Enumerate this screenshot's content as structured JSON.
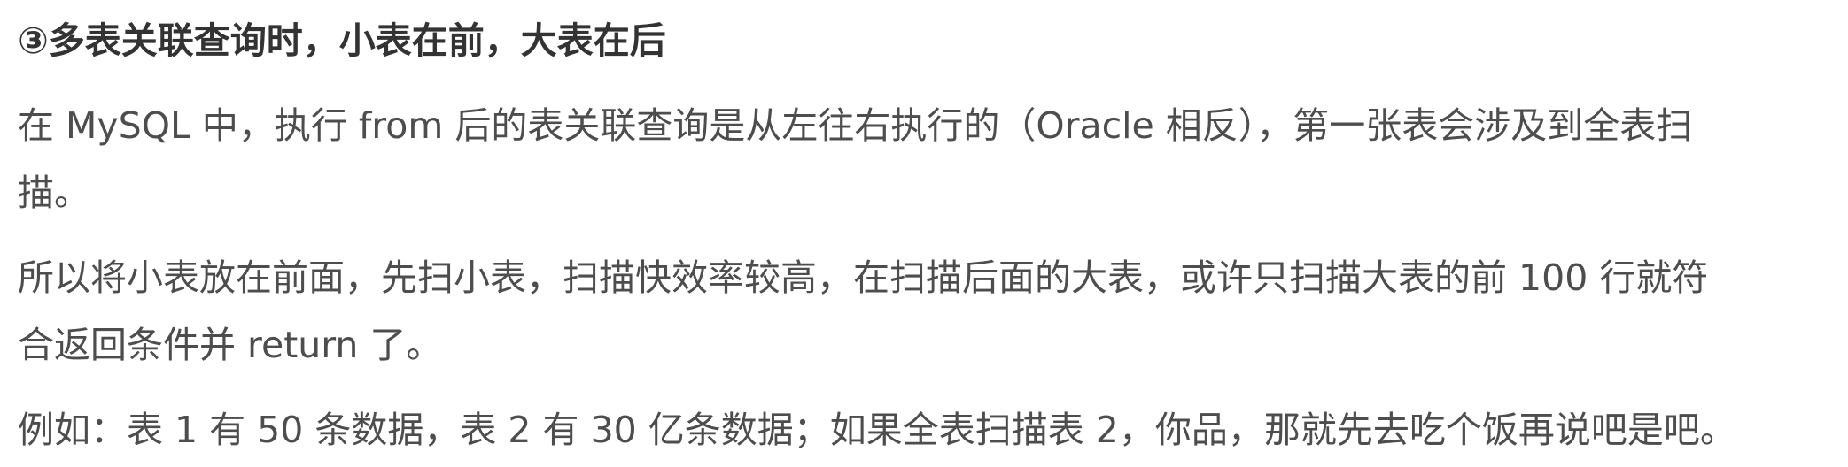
{
  "heading": "③多表关联查询时，小表在前，大表在后",
  "paragraphs": [
    {
      "lines": [
        "在 MySQL 中，执行 from 后的表关联查询是从左往右执行的（Oracle 相反），第一张表会涉及到全表扫",
        "描。"
      ]
    },
    {
      "lines": [
        "所以将小表放在前面，先扫小表，扫描快效率较高，在扫描后面的大表，或许只扫描大表的前 100 行就符",
        "合返回条件并 return 了。"
      ]
    },
    {
      "lines": [
        "例如：表 1 有 50 条数据，表 2 有 30 亿条数据；如果全表扫描表 2，你品，那就先去吃个饭再说吧是吧。"
      ]
    }
  ]
}
